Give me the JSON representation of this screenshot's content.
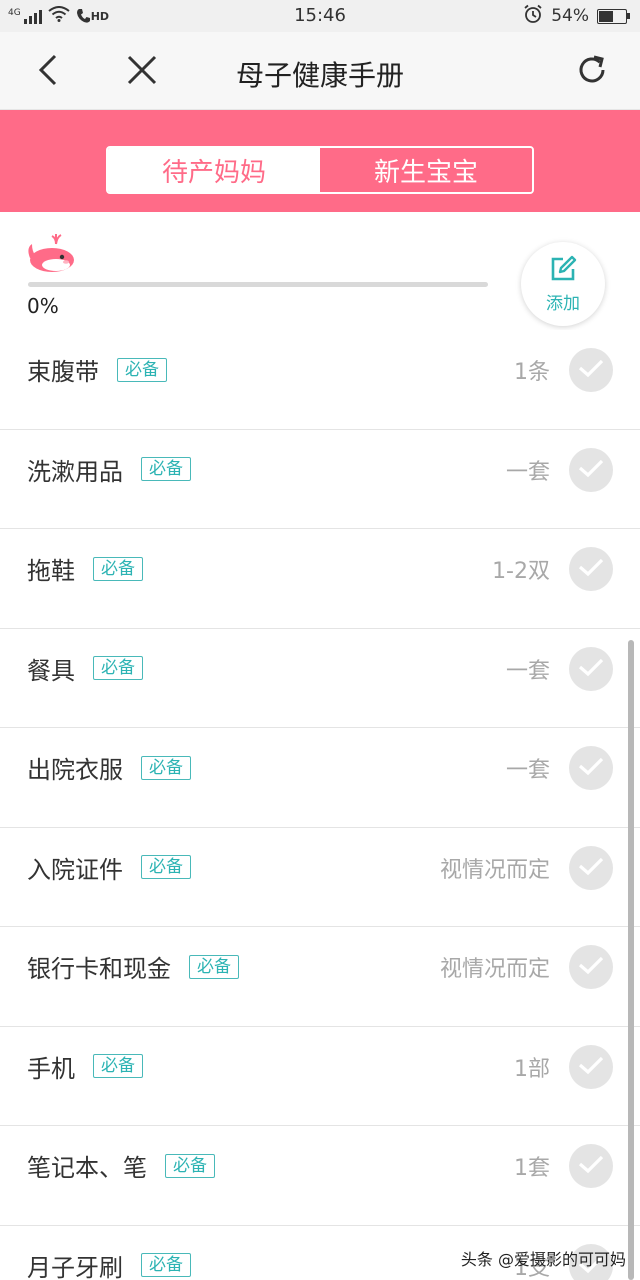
{
  "status_bar": {
    "network": "4G",
    "hd": "HD",
    "time": "15:46",
    "battery": "54%",
    "battery_level": 0.54
  },
  "nav": {
    "title": "母子健康手册",
    "back_icon": "chevron-left-icon",
    "close_icon": "close-icon",
    "refresh_icon": "refresh-icon"
  },
  "tabs": {
    "items": [
      {
        "label": "待产妈妈",
        "active": true
      },
      {
        "label": "新生宝宝",
        "active": false
      }
    ]
  },
  "progress": {
    "percent_text": "0%",
    "value": 0,
    "add_label": "添加"
  },
  "checklist": [
    {
      "name": "束腹带",
      "tag": "必备",
      "qty": "1条"
    },
    {
      "name": "洗漱用品",
      "tag": "必备",
      "qty": "一套"
    },
    {
      "name": "拖鞋",
      "tag": "必备",
      "qty": "1-2双"
    },
    {
      "name": "餐具",
      "tag": "必备",
      "qty": "一套"
    },
    {
      "name": "出院衣服",
      "tag": "必备",
      "qty": "一套"
    },
    {
      "name": "入院证件",
      "tag": "必备",
      "qty": "视情况而定"
    },
    {
      "name": "银行卡和现金",
      "tag": "必备",
      "qty": "视情况而定"
    },
    {
      "name": "手机",
      "tag": "必备",
      "qty": "1部"
    },
    {
      "name": "笔记本、笔",
      "tag": "必备",
      "qty": "1套"
    },
    {
      "name": "月子牙刷",
      "tag": "必备",
      "qty": "1支"
    }
  ],
  "watermark": "头条 @爱摄影的可可妈",
  "colors": {
    "accent_pink": "#ff6b88",
    "tag_teal": "#2cb3b3",
    "check_gray": "#e4e4e4"
  }
}
